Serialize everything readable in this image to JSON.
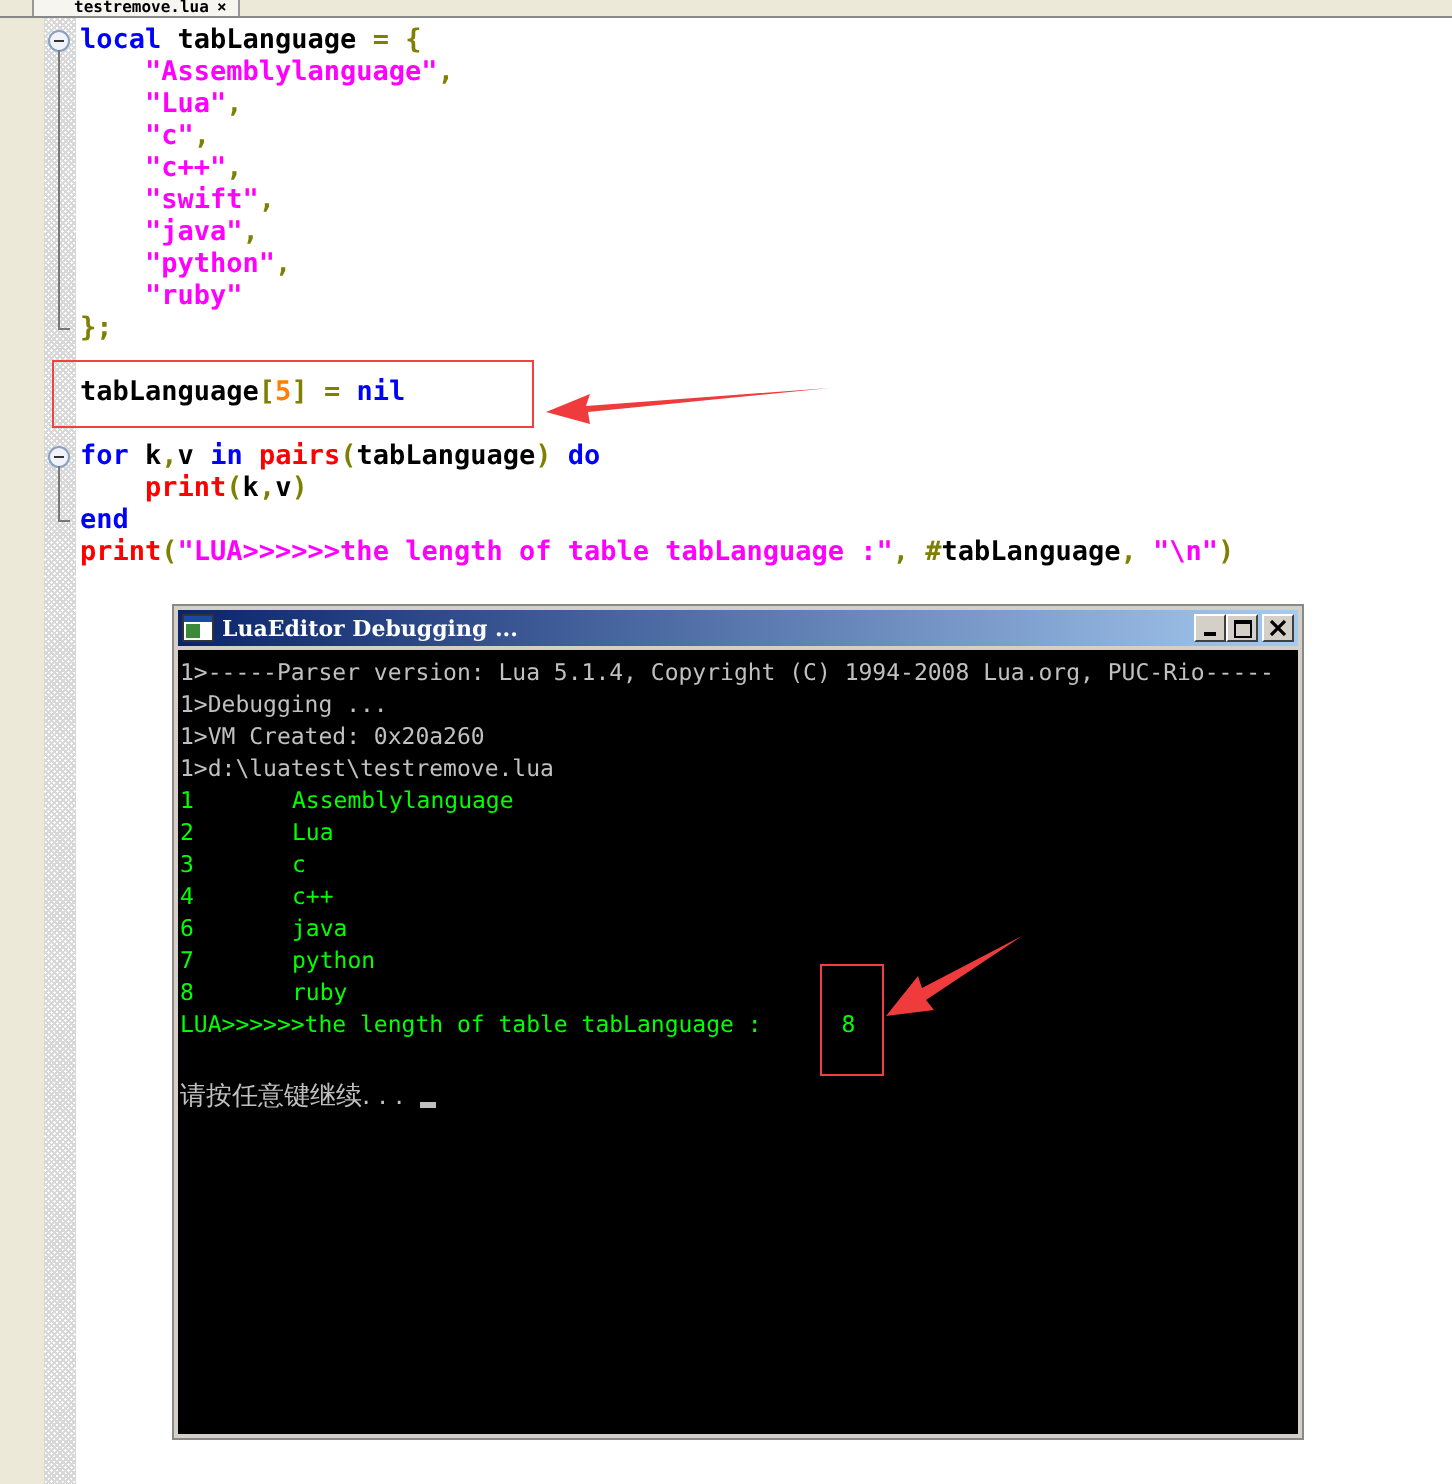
{
  "tab": {
    "label": "testremove.lua",
    "close": "×"
  },
  "code": [
    {
      "kind": "code",
      "expanded": true,
      "tokens": [
        {
          "kind": "keyword",
          "text": "local"
        },
        {
          "kind": "ident",
          "text": " tabLanguage "
        },
        {
          "kind": "punct",
          "text": "= {"
        }
      ],
      "children": [
        {
          "kind": "code",
          "tokens": [
            {
              "kind": "string",
              "text": "    \"Assemblylanguage\""
            },
            {
              "kind": "punct",
              "text": ","
            }
          ]
        },
        {
          "kind": "code",
          "tokens": [
            {
              "kind": "string",
              "text": "    \"Lua\""
            },
            {
              "kind": "punct",
              "text": ","
            }
          ]
        },
        {
          "kind": "code",
          "tokens": [
            {
              "kind": "string",
              "text": "    \"c\""
            },
            {
              "kind": "punct",
              "text": ","
            }
          ]
        },
        {
          "kind": "code",
          "tokens": [
            {
              "kind": "string",
              "text": "    \"c++\""
            },
            {
              "kind": "punct",
              "text": ","
            }
          ]
        },
        {
          "kind": "code",
          "tokens": [
            {
              "kind": "string",
              "text": "    \"swift\""
            },
            {
              "kind": "punct",
              "text": ","
            }
          ]
        },
        {
          "kind": "code",
          "tokens": [
            {
              "kind": "string",
              "text": "    \"java\""
            },
            {
              "kind": "punct",
              "text": ","
            }
          ]
        },
        {
          "kind": "code",
          "tokens": [
            {
              "kind": "string",
              "text": "    \"python\""
            },
            {
              "kind": "punct",
              "text": ","
            }
          ]
        },
        {
          "kind": "code",
          "tokens": [
            {
              "kind": "string",
              "text": "    \"ruby\""
            }
          ]
        },
        {
          "kind": "code",
          "tokens": [
            {
              "kind": "punct",
              "text": "};"
            }
          ]
        }
      ]
    },
    {
      "kind": "blank"
    },
    {
      "kind": "code",
      "tokens": [
        {
          "kind": "ident",
          "text": "tabLanguage"
        },
        {
          "kind": "punct",
          "text": "["
        },
        {
          "kind": "number",
          "text": "5"
        },
        {
          "kind": "punct",
          "text": "] = "
        },
        {
          "kind": "keyword",
          "text": "nil"
        }
      ]
    },
    {
      "kind": "blank"
    },
    {
      "kind": "code",
      "expanded": true,
      "tokens": [
        {
          "kind": "keyword",
          "text": "for"
        },
        {
          "kind": "ident",
          "text": " k"
        },
        {
          "kind": "punct",
          "text": ","
        },
        {
          "kind": "ident",
          "text": "v "
        },
        {
          "kind": "keyword",
          "text": "in "
        },
        {
          "kind": "builtin",
          "text": "pairs"
        },
        {
          "kind": "punct",
          "text": "("
        },
        {
          "kind": "ident",
          "text": "tabLanguage"
        },
        {
          "kind": "punct",
          "text": ")"
        },
        {
          "kind": "keyword",
          "text": " do"
        }
      ],
      "children": [
        {
          "kind": "code",
          "tokens": [
            {
              "kind": "builtin",
              "text": "    print"
            },
            {
              "kind": "punct",
              "text": "("
            },
            {
              "kind": "ident",
              "text": "k"
            },
            {
              "kind": "punct",
              "text": ","
            },
            {
              "kind": "ident",
              "text": "v"
            },
            {
              "kind": "punct",
              "text": ")"
            }
          ]
        },
        {
          "kind": "code",
          "tokens": [
            {
              "kind": "keyword",
              "text": "end"
            }
          ]
        }
      ]
    },
    {
      "kind": "code",
      "tokens": [
        {
          "kind": "builtin",
          "text": "print"
        },
        {
          "kind": "punct",
          "text": "("
        },
        {
          "kind": "string",
          "text": "\"LUA>>>>>>the length of table tabLanguage :\""
        },
        {
          "kind": "punct",
          "text": ", #"
        },
        {
          "kind": "ident",
          "text": "tabLanguage"
        },
        {
          "kind": "punct",
          "text": ", "
        },
        {
          "kind": "string",
          "text": "\"\\n\""
        },
        {
          "kind": "punct",
          "text": ")"
        }
      ]
    }
  ],
  "console": {
    "title": "LuaEditor Debugging ...",
    "lines": [
      {
        "kind": "system",
        "text": "1>-----Parser version: Lua 5.1.4, Copyright (C) 1994-2008 Lua.org, PUC-Rio-----"
      },
      {
        "kind": "system",
        "text": "1>Debugging ..."
      },
      {
        "kind": "system",
        "text": "1>VM Created: 0x20a260"
      },
      {
        "kind": "system",
        "text": "1>d:\\luatest\\testremove.lua"
      },
      {
        "kind": "pair",
        "index": "1",
        "value": "Assemblylanguage"
      },
      {
        "kind": "pair",
        "index": "2",
        "value": "Lua"
      },
      {
        "kind": "pair",
        "index": "3",
        "value": "c"
      },
      {
        "kind": "pair",
        "index": "4",
        "value": "c++"
      },
      {
        "kind": "pair",
        "index": "6",
        "value": "java"
      },
      {
        "kind": "pair",
        "index": "7",
        "value": "python"
      },
      {
        "kind": "pair",
        "index": "8",
        "value": "ruby"
      },
      {
        "kind": "result",
        "text": "LUA>>>>>>the length of table tabLanguage :",
        "value": "8"
      },
      {
        "kind": "blank"
      },
      {
        "kind": "prompt",
        "text": "请按任意键继续. . ."
      }
    ]
  }
}
